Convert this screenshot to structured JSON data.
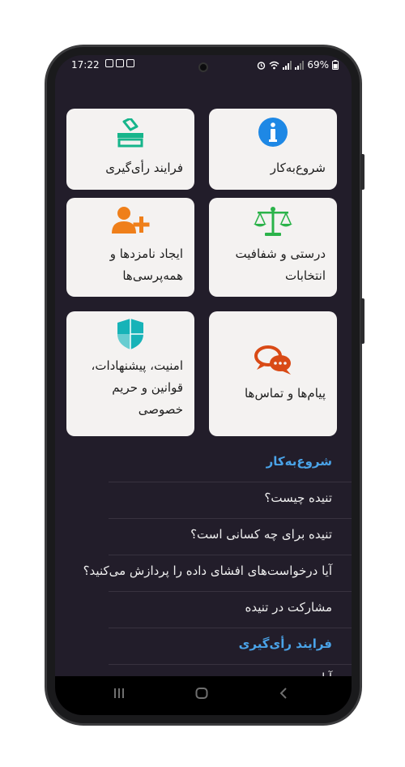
{
  "status_bar": {
    "time": "17:22",
    "battery": "69%"
  },
  "cards": [
    {
      "label": "شروع‌به‌کار",
      "icon": "info-icon",
      "color": "#1e88e5"
    },
    {
      "label": "فرایند رأی‌گیری",
      "icon": "ballot-box-icon",
      "color": "#16b58b"
    },
    {
      "label": "درستی و شفافیت انتخابات",
      "icon": "scales-icon",
      "color": "#2bb34a"
    },
    {
      "label": "ایجاد نامزدها و همه‌پرسی‌ها",
      "icon": "add-user-icon",
      "color": "#ef7f1a"
    },
    {
      "label": "پیام‌ها و تماس‌ها",
      "icon": "chat-bubbles-icon",
      "color": "#d94a16"
    },
    {
      "label": "امنیت، پیشنهادات، قوانین و حریم خصوصی",
      "icon": "shield-icon",
      "color": "#17b3b8"
    }
  ],
  "list": {
    "section1_title": "شروع‌به‌کار",
    "items": [
      "تنیده چیست؟",
      "تنیده برای چه کسانی است؟",
      "آیا درخواست‌های افشای داده را پردازش می‌کنید؟",
      "مشارکت در تنیده"
    ],
    "section2_title": "فرایند رأی‌گیری",
    "partial_item": "آیا ..."
  },
  "colors": {
    "background": "#221d2a",
    "card": "#f4f2f1",
    "accent": "#4aa3e8"
  }
}
